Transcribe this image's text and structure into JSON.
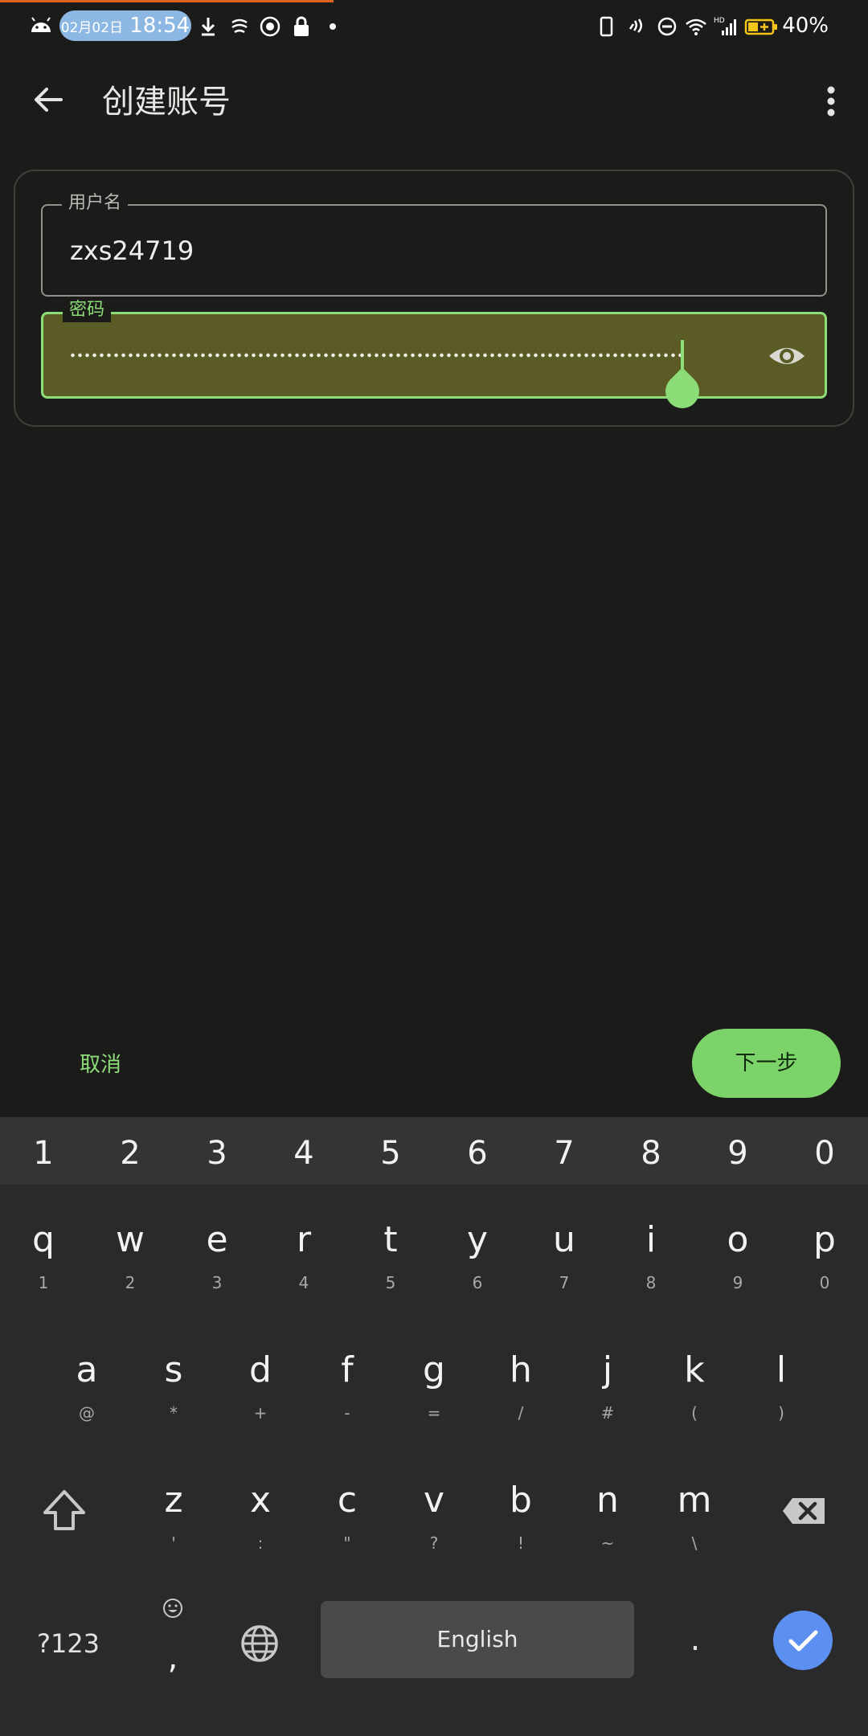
{
  "status_bar": {
    "date": "02月02日",
    "time": "18:54",
    "battery": "40%",
    "icons": [
      "android-icon",
      "download-icon",
      "fan-icon",
      "record-icon",
      "lock-icon",
      "dot-icon",
      "phone-icon",
      "nfc-icon",
      "dnd-icon",
      "wifi-icon",
      "hd-signal-icon",
      "battery-icon"
    ]
  },
  "app_bar": {
    "title": "创建账号",
    "back_icon": "arrow-left-icon",
    "menu_icon": "more-vert-icon"
  },
  "form": {
    "username": {
      "label": "用户名",
      "value": "zxs24719"
    },
    "password": {
      "label": "密码",
      "masked": true,
      "toggle_icon": "eye-icon"
    }
  },
  "actions": {
    "cancel": "取消",
    "next": "下一步"
  },
  "colors": {
    "background": "#1b1c1a",
    "accent": "#8cdc78",
    "primary_button": "#7bd36a",
    "password_fill": "#5b5b25",
    "enter_key": "#5b8ff0"
  },
  "keyboard": {
    "numbers": [
      "1",
      "2",
      "3",
      "4",
      "5",
      "6",
      "7",
      "8",
      "9",
      "0"
    ],
    "row1": [
      {
        "key": "q",
        "hint": "1"
      },
      {
        "key": "w",
        "hint": "2"
      },
      {
        "key": "e",
        "hint": "3"
      },
      {
        "key": "r",
        "hint": "4"
      },
      {
        "key": "t",
        "hint": "5"
      },
      {
        "key": "y",
        "hint": "6"
      },
      {
        "key": "u",
        "hint": "7"
      },
      {
        "key": "i",
        "hint": "8"
      },
      {
        "key": "o",
        "hint": "9"
      },
      {
        "key": "p",
        "hint": "0"
      }
    ],
    "row2": [
      {
        "key": "a",
        "hint": "@"
      },
      {
        "key": "s",
        "hint": "*"
      },
      {
        "key": "d",
        "hint": "+"
      },
      {
        "key": "f",
        "hint": "-"
      },
      {
        "key": "g",
        "hint": "="
      },
      {
        "key": "h",
        "hint": "/"
      },
      {
        "key": "j",
        "hint": "#"
      },
      {
        "key": "k",
        "hint": "("
      },
      {
        "key": "l",
        "hint": ")"
      }
    ],
    "row3": [
      {
        "key": "z",
        "hint": "'"
      },
      {
        "key": "x",
        "hint": ":"
      },
      {
        "key": "c",
        "hint": "\""
      },
      {
        "key": "v",
        "hint": "?"
      },
      {
        "key": "b",
        "hint": "!"
      },
      {
        "key": "n",
        "hint": "~"
      },
      {
        "key": "m",
        "hint": "\\"
      }
    ],
    "symbols_label": "?123",
    "comma": ",",
    "space_label": "English",
    "period": "."
  }
}
